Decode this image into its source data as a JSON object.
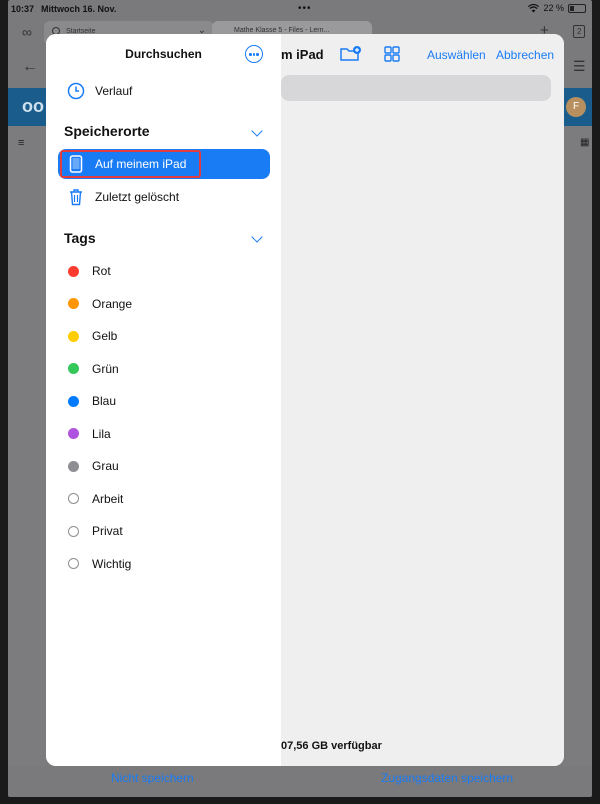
{
  "statusbar": {
    "time": "10:37",
    "date": "Mittwoch 16. Nov.",
    "dots": "•••",
    "battery": "22 %"
  },
  "browser": {
    "tab1": "Startseite",
    "tab2": "Mathe Klasse 5 - Files - Lern...",
    "tab_count": "2"
  },
  "content": {
    "title": "m iPad",
    "select_link": "Auswählen",
    "cancel_link": "Abbrechen",
    "storage": "07,56 GB verfügbar"
  },
  "sidebar": {
    "title": "Durchsuchen",
    "recents": "Verlauf",
    "locations_header": "Speicherorte",
    "locations": [
      {
        "label": "Auf meinem iPad",
        "icon": "ipad-icon"
      },
      {
        "label": "Zuletzt gelöscht",
        "icon": "trash-icon"
      }
    ],
    "tags_header": "Tags",
    "tags": [
      {
        "label": "Rot",
        "color": "#ff3b30"
      },
      {
        "label": "Orange",
        "color": "#ff9500"
      },
      {
        "label": "Gelb",
        "color": "#ffcc00"
      },
      {
        "label": "Grün",
        "color": "#34c759"
      },
      {
        "label": "Blau",
        "color": "#007aff"
      },
      {
        "label": "Lila",
        "color": "#af52de"
      },
      {
        "label": "Grau",
        "color": "#8e8e93"
      },
      {
        "label": "Arbeit",
        "color": ""
      },
      {
        "label": "Privat",
        "color": ""
      },
      {
        "label": "Wichtig",
        "color": ""
      }
    ]
  },
  "bottom": {
    "left_link": "Nicht speichern",
    "right_link": "Zugangsdaten speichern"
  },
  "colors": {
    "accent": "#1a7cf5",
    "nextcloud_blue": "#1a5d8c",
    "highlight_outline": "#e23c3c"
  }
}
